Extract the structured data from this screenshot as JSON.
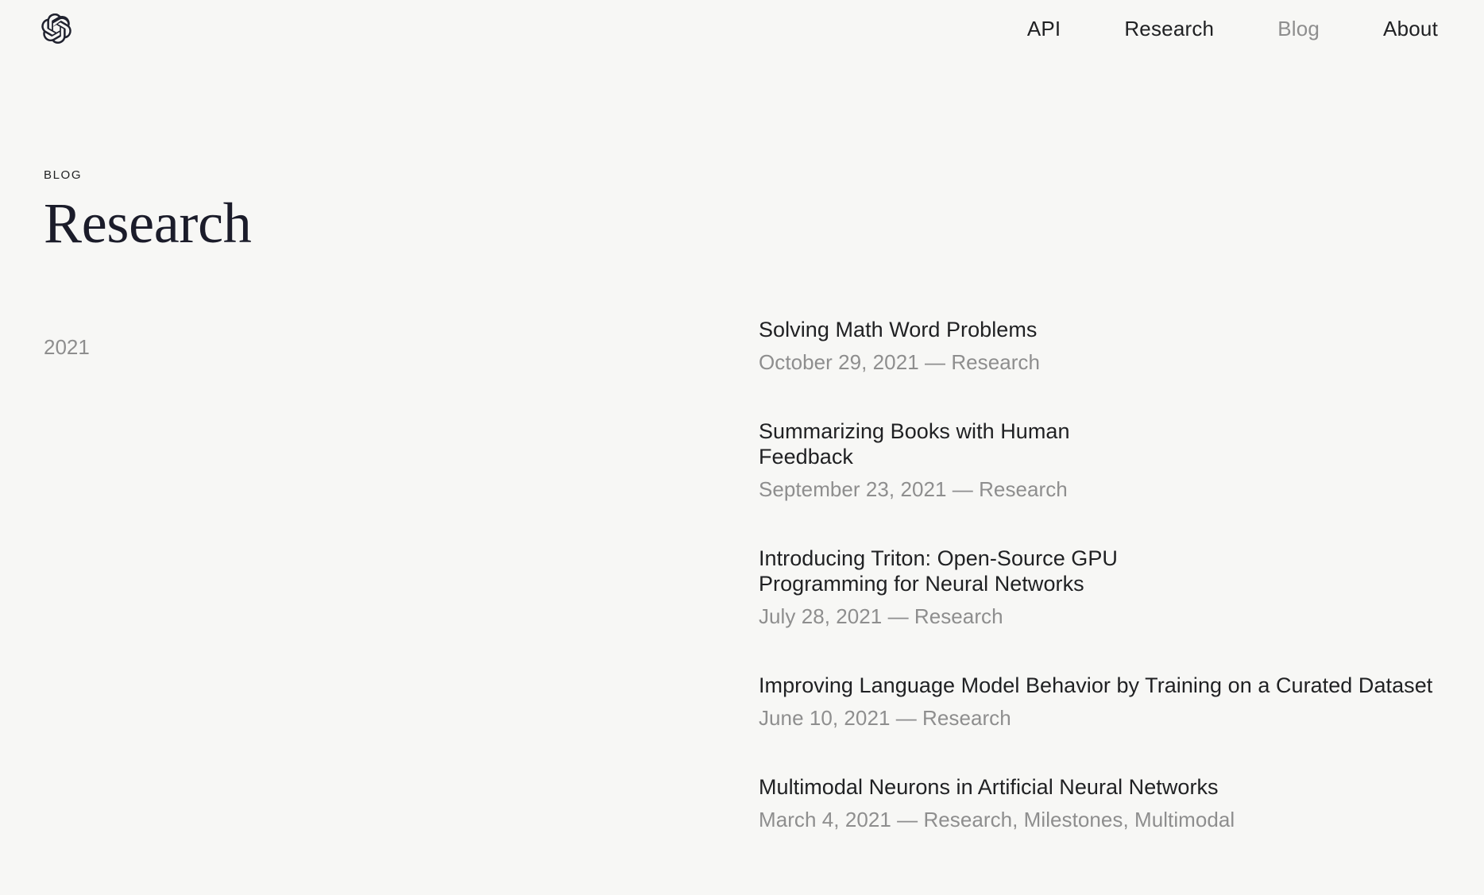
{
  "header": {
    "logo": {
      "icon": "openai-logo-icon",
      "label": "OpenAI"
    },
    "nav": [
      {
        "label": "API",
        "muted": false
      },
      {
        "label": "Research",
        "muted": false
      },
      {
        "label": "Blog",
        "muted": true
      },
      {
        "label": "About",
        "muted": false
      }
    ]
  },
  "page": {
    "eyebrow": "BLOG",
    "title": "Research"
  },
  "archive": {
    "groups": [
      {
        "year": "2021",
        "posts": [
          {
            "title": "Solving Math Word Problems",
            "meta": "October 29, 2021 — Research",
            "date": "October 29, 2021",
            "tags": "Research",
            "wide": false
          },
          {
            "title": "Summarizing Books with Human Feedback",
            "meta": "September 23, 2021 — Research",
            "date": "September 23, 2021",
            "tags": "Research",
            "wide": false
          },
          {
            "title": "Introducing Triton: Open-Source GPU Programming for Neural Networks",
            "meta": "July 28, 2021 — Research",
            "date": "July 28, 2021",
            "tags": "Research",
            "wide": false
          },
          {
            "title": "Improving Language Model Behavior by Training on a Curated Dataset",
            "meta": "June 10, 2021 — Research",
            "date": "June 10, 2021",
            "tags": "Research",
            "wide": true
          },
          {
            "title": "Multimodal Neurons in Artificial Neural Networks",
            "meta": "March 4, 2021 — Research, Milestones, Multimodal",
            "date": "March 4, 2021",
            "tags": "Research, Milestones, Multimodal",
            "wide": true
          }
        ]
      }
    ]
  },
  "colors": {
    "background": "#f7f7f5",
    "text": "#202123",
    "muted": "#8e8e8e",
    "title": "#1b1c2a"
  }
}
